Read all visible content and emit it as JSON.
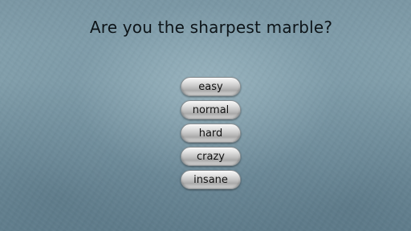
{
  "title": "Are you the sharpest marble?",
  "menu": {
    "options": [
      {
        "label": "easy"
      },
      {
        "label": "normal"
      },
      {
        "label": "hard"
      },
      {
        "label": "crazy"
      },
      {
        "label": "insane"
      }
    ]
  }
}
